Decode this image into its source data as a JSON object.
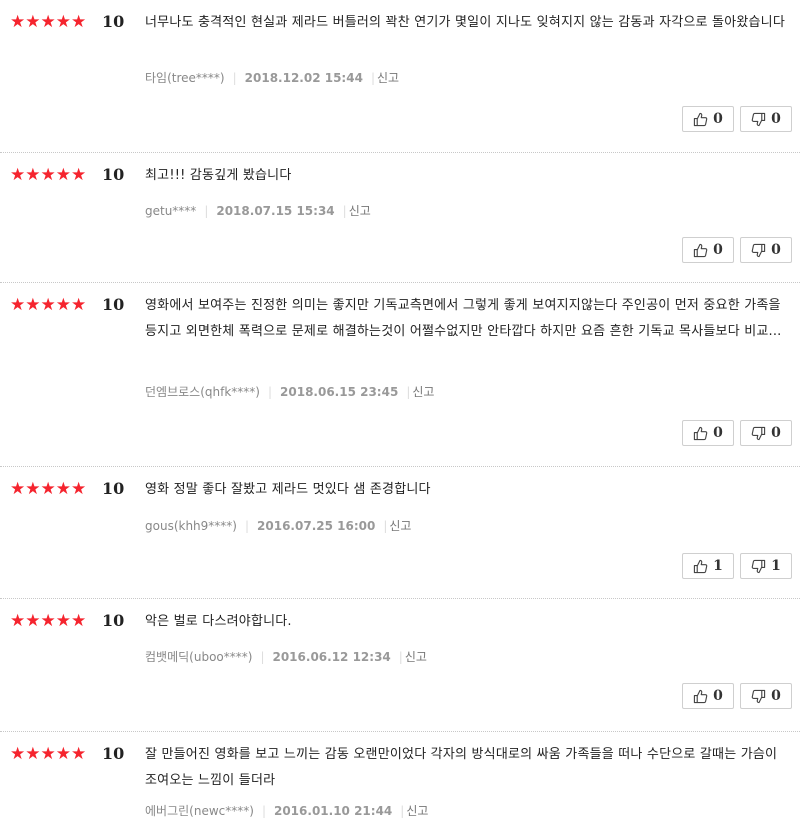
{
  "reviews": [
    {
      "stars": "★★★★★",
      "score": "10",
      "content": "너무나도 충격적인 현실과 제라드 버틀러의 꽉찬 연기가 몇일이 지나도 잊혀지지 않는 감동과 자각으로 돌아왔습니다",
      "author": "타임(tree****)",
      "date": "2018.12.02 15:44",
      "report": "신고",
      "likes": "0",
      "dislikes": "0"
    },
    {
      "stars": "★★★★★",
      "score": "10",
      "content": "최고!!! 감동깊게 봤습니다",
      "author": "getu****",
      "date": "2018.07.15 15:34",
      "report": "신고",
      "likes": "0",
      "dislikes": "0"
    },
    {
      "stars": "★★★★★",
      "score": "10",
      "content": "영화에서 보여주는 진정한 의미는 좋지만 기독교측면에서 그렇게 좋게 보여지지않는다 주인공이 먼저 중요한 가족을 등지고 외면한체 폭력으로 문제로 해결하는것이 어쩔수없지만 안타깝다 하지만 요즘 흔한 기독교 목사들보다 비교...",
      "author": "던엠브로스(qhfk****)",
      "date": "2018.06.15 23:45",
      "report": "신고",
      "likes": "0",
      "dislikes": "0"
    },
    {
      "stars": "★★★★★",
      "score": "10",
      "content": "영화 정말 좋다 잘봤고 제라드 멋있다 샘 존경합니다",
      "author": "gous(khh9****)",
      "date": "2016.07.25 16:00",
      "report": "신고",
      "likes": "1",
      "dislikes": "1"
    },
    {
      "stars": "★★★★★",
      "score": "10",
      "content": "악은 벌로 다스려야합니다.",
      "author": "컴뱃메딕(uboo****)",
      "date": "2016.06.12 12:34",
      "report": "신고",
      "likes": "0",
      "dislikes": "0"
    },
    {
      "stars": "★★★★★",
      "score": "10",
      "content": "잘 만들어진 영화를 보고 느끼는 감동 오랜만이었다 각자의 방식대로의 싸움 가족들을 떠나 수단으로 갈때는 가슴이 조여오는 느낌이 들더라",
      "author": "에버그린(newc****)",
      "date": "2016.01.10 21:44",
      "report": "신고"
    }
  ]
}
